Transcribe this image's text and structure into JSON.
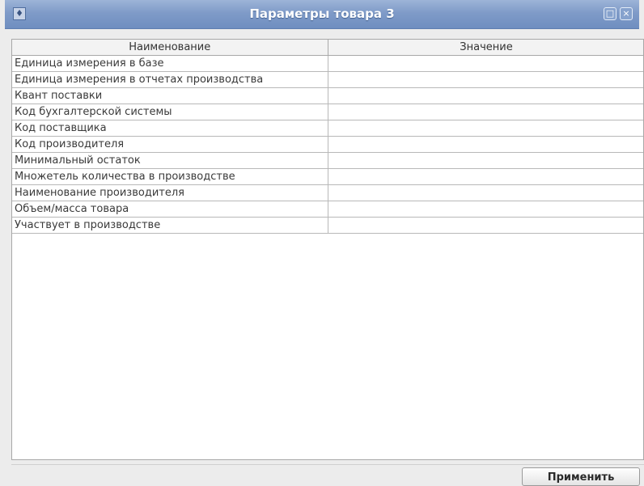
{
  "window": {
    "title": "Параметры товара 3"
  },
  "icons": {
    "app": "app-icon",
    "maximize": "maximize-icon",
    "close": "close-icon"
  },
  "table": {
    "headers": [
      "Наименование",
      "Значение"
    ],
    "rows": [
      [
        "Единица измерения в базе",
        ""
      ],
      [
        "Единица измерения в отчетах производства",
        ""
      ],
      [
        "Квант поставки",
        ""
      ],
      [
        "Код бухгалтерской системы",
        ""
      ],
      [
        "Код поставщика",
        ""
      ],
      [
        "Код производителя",
        ""
      ],
      [
        "Минимальный остаток",
        ""
      ],
      [
        "Множетель количества в производстве",
        ""
      ],
      [
        "Наименование производителя",
        ""
      ],
      [
        "Объем/масса товара",
        ""
      ],
      [
        "Участвует в производстве",
        ""
      ]
    ]
  },
  "footer": {
    "apply_label": "Применить"
  }
}
